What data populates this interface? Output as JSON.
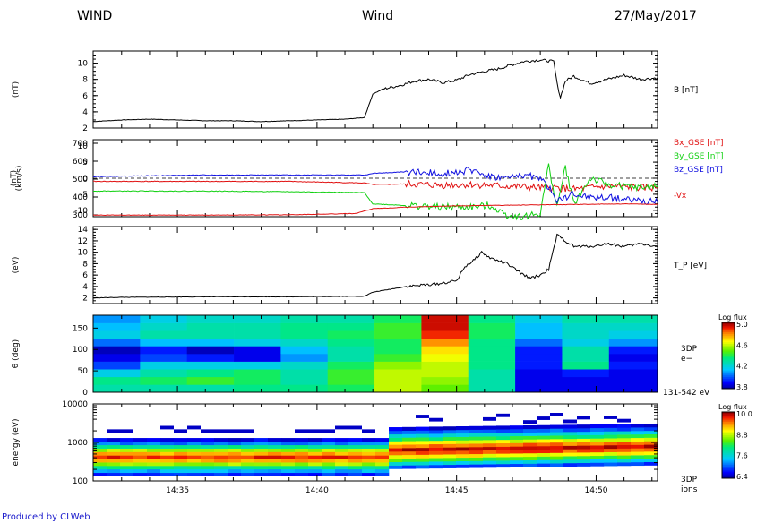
{
  "header": {
    "left": "WIND",
    "center": "Wind",
    "right": "27/May/2017"
  },
  "footer": "Produced by CLWeb",
  "colors": {
    "red": "#e01010",
    "green": "#10d010",
    "blue": "#1010e0",
    "black": "#000000"
  },
  "time_ticks": [
    "14:35",
    "14:40",
    "14:45",
    "14:50"
  ],
  "chart_data": [
    {
      "type": "line",
      "ylabel": "(nT)",
      "yticks": [
        2,
        4,
        6,
        8,
        10
      ],
      "ylim": [
        2,
        11.5
      ],
      "xlim": [
        14.533,
        14.87
      ],
      "series": [
        {
          "name": "B [nT]",
          "color": "#000000",
          "x": [
            14.533,
            14.55,
            14.567,
            14.583,
            14.6,
            14.617,
            14.633,
            14.65,
            14.667,
            14.684,
            14.695,
            14.7,
            14.706,
            14.717,
            14.725,
            14.733,
            14.742,
            14.75,
            14.758,
            14.767,
            14.775,
            14.783,
            14.79,
            14.8,
            14.808,
            14.81,
            14.812,
            14.815,
            14.82,
            14.83,
            14.84,
            14.85,
            14.86,
            14.87
          ],
          "y": [
            2.8,
            3.0,
            3.1,
            3.0,
            2.9,
            2.9,
            2.8,
            2.9,
            3.0,
            3.1,
            3.3,
            6.2,
            6.8,
            7.3,
            7.8,
            8.0,
            7.6,
            7.9,
            8.6,
            9.0,
            9.3,
            9.8,
            10.2,
            10.4,
            10.2,
            7.5,
            5.8,
            7.8,
            8.4,
            7.5,
            8.0,
            8.5,
            8.0,
            8.2
          ]
        }
      ]
    },
    {
      "type": "line",
      "ylabel": "(nT)",
      "ylabel_overlay": "(km/s)",
      "yticks_left": [
        "700",
        "600",
        "500",
        "400",
        "300"
      ],
      "yticks_overlay": [
        "10",
        "5",
        "0",
        "-5",
        "-10"
      ],
      "ylim": [
        -12,
        12
      ],
      "xlim": [
        14.533,
        14.87
      ],
      "zero_line": true,
      "series": [
        {
          "name": "Bx_GSE [nT]",
          "color": "#e01010",
          "x": [
            14.533,
            14.6,
            14.65,
            14.695,
            14.7,
            14.72,
            14.74,
            14.76,
            14.78,
            14.8,
            14.81,
            14.82,
            14.84,
            14.86,
            14.87
          ],
          "y": [
            -1.0,
            -1.0,
            -1.0,
            -1.5,
            -2.0,
            -1.8,
            -2.2,
            -2.0,
            -2.5,
            -3.0,
            -3.0,
            -3.5,
            -2.5,
            -3.0,
            -3.0
          ]
        },
        {
          "name": "By_GSE [nT]",
          "color": "#10d010",
          "x": [
            14.533,
            14.6,
            14.65,
            14.695,
            14.7,
            14.72,
            14.74,
            14.76,
            14.77,
            14.78,
            14.79,
            14.8,
            14.805,
            14.81,
            14.815,
            14.82,
            14.83,
            14.84,
            14.86,
            14.87
          ],
          "y": [
            -4.0,
            -4.0,
            -4.2,
            -4.5,
            -8.0,
            -8.5,
            -9.0,
            -9.0,
            -8.5,
            -11.5,
            -12.0,
            -11.0,
            4.0,
            -9.0,
            3.5,
            -8.0,
            0.0,
            -2.0,
            -3.0,
            -2.5
          ]
        },
        {
          "name": "Bz_GSE [nT]",
          "color": "#1010e0",
          "x": [
            14.533,
            14.6,
            14.65,
            14.695,
            14.7,
            14.72,
            14.74,
            14.76,
            14.77,
            14.78,
            14.79,
            14.8,
            14.805,
            14.81,
            14.82,
            14.83,
            14.84,
            14.86,
            14.87
          ],
          "y": [
            0.5,
            1.0,
            1.0,
            1.0,
            1.5,
            2.0,
            1.5,
            2.5,
            0.5,
            0.0,
            1.0,
            0.0,
            -3.0,
            -7.0,
            -5.0,
            -6.0,
            -6.0,
            -7.0,
            -7.5
          ]
        },
        {
          "name": "-Vx",
          "color": "#e01010",
          "x": [
            14.533,
            14.6,
            14.65,
            14.69,
            14.7,
            14.72,
            14.75,
            14.8,
            14.85,
            14.87
          ],
          "y": [
            -11.5,
            -11.5,
            -11.4,
            -11.0,
            -9.5,
            -9.0,
            -8.6,
            -8.3,
            -8.0,
            -8.2
          ]
        }
      ]
    },
    {
      "type": "line",
      "ylabel": "(eV)",
      "yticks": [
        2,
        4,
        6,
        8,
        10,
        12,
        14
      ],
      "ylim": [
        1,
        14.5
      ],
      "xlim": [
        14.533,
        14.87
      ],
      "series": [
        {
          "name": "T_P [eV]",
          "color": "#000000",
          "x": [
            14.533,
            14.55,
            14.6,
            14.65,
            14.695,
            14.7,
            14.72,
            14.74,
            14.75,
            14.755,
            14.76,
            14.765,
            14.77,
            14.78,
            14.79,
            14.795,
            14.8,
            14.805,
            14.81,
            14.82,
            14.83,
            14.84,
            14.85,
            14.86,
            14.87
          ],
          "y": [
            2.0,
            2.1,
            2.2,
            2.2,
            2.3,
            3.0,
            4.0,
            4.5,
            5.0,
            7.5,
            8.5,
            10.0,
            9.0,
            8.0,
            6.0,
            5.5,
            6.0,
            7.0,
            13.0,
            11.0,
            11.0,
            11.5,
            11.0,
            11.5,
            11.0
          ]
        }
      ]
    },
    {
      "type": "heatmap",
      "ylabel": "θ (deg)",
      "yticks": [
        0,
        50,
        100,
        150
      ],
      "ylim": [
        0,
        180
      ],
      "side_label": "3DP e−",
      "range_label": "131-542 eV",
      "colorbar": {
        "title": "Log flux",
        "ticks": [
          "5.0",
          "4.6",
          "4.2",
          "3.8"
        ],
        "min": 3.8,
        "max": 5.0
      },
      "t_bins": [
        14.533,
        14.561,
        14.589,
        14.617,
        14.645,
        14.673,
        14.701,
        14.729,
        14.757,
        14.785,
        14.813,
        14.841,
        14.87
      ],
      "theta_bins": [
        0,
        18,
        36,
        54,
        72,
        90,
        108,
        126,
        144,
        162,
        180
      ],
      "values": [
        [
          4.3,
          4.3,
          4.3,
          4.35,
          4.35,
          4.4,
          4.6,
          4.5,
          4.3,
          3.9,
          3.9,
          3.9
        ],
        [
          4.35,
          4.4,
          4.45,
          4.4,
          4.3,
          4.45,
          4.6,
          4.55,
          4.3,
          3.9,
          3.9,
          3.9
        ],
        [
          4.2,
          4.3,
          4.35,
          4.4,
          4.3,
          4.45,
          4.6,
          4.6,
          4.3,
          3.9,
          3.95,
          3.9
        ],
        [
          4.0,
          4.2,
          4.2,
          4.2,
          4.25,
          4.4,
          4.55,
          4.6,
          4.35,
          3.95,
          4.35,
          3.95
        ],
        [
          3.9,
          4.0,
          3.95,
          3.9,
          4.1,
          4.3,
          4.45,
          4.65,
          4.35,
          3.95,
          4.3,
          3.9
        ],
        [
          3.85,
          3.95,
          3.85,
          3.9,
          4.15,
          4.3,
          4.4,
          4.7,
          4.35,
          3.95,
          4.3,
          3.95
        ],
        [
          4.05,
          4.15,
          4.15,
          4.2,
          4.25,
          4.35,
          4.4,
          4.8,
          4.35,
          4.05,
          4.2,
          4.1
        ],
        [
          4.2,
          4.3,
          4.3,
          4.3,
          4.35,
          4.4,
          4.45,
          4.9,
          4.4,
          4.15,
          4.25,
          4.2
        ],
        [
          4.15,
          4.25,
          4.3,
          4.3,
          4.35,
          4.35,
          4.45,
          4.95,
          4.4,
          4.15,
          4.25,
          4.25
        ],
        [
          4.1,
          4.2,
          4.25,
          4.25,
          4.3,
          4.3,
          4.4,
          4.95,
          4.35,
          4.2,
          4.3,
          4.3
        ]
      ]
    },
    {
      "type": "heatmap",
      "ylabel": "energy (eV)",
      "yticks": [
        "100",
        "1000",
        "10000"
      ],
      "ylim_log10": [
        2,
        4
      ],
      "side_label": "3DP ions",
      "colorbar": {
        "title": "Log flux",
        "ticks": [
          "10.0",
          "8.8",
          "7.6",
          "6.4"
        ],
        "min": 6.4,
        "max": 10.0
      },
      "xlim": [
        14.533,
        14.87
      ],
      "transition_time": 14.702,
      "pre": {
        "center_log10": 2.62,
        "levels": [
          6.9,
          7.4,
          8.0,
          8.7,
          9.3,
          9.7,
          9.3,
          8.7,
          8.0,
          7.2,
          6.7
        ]
      },
      "post": {
        "center_log10": 2.85,
        "levels": [
          7.0,
          7.6,
          8.4,
          9.0,
          9.6,
          9.9,
          9.5,
          8.9,
          8.2,
          7.6,
          7.1,
          6.7
        ]
      },
      "log10_step": 0.09
    }
  ]
}
